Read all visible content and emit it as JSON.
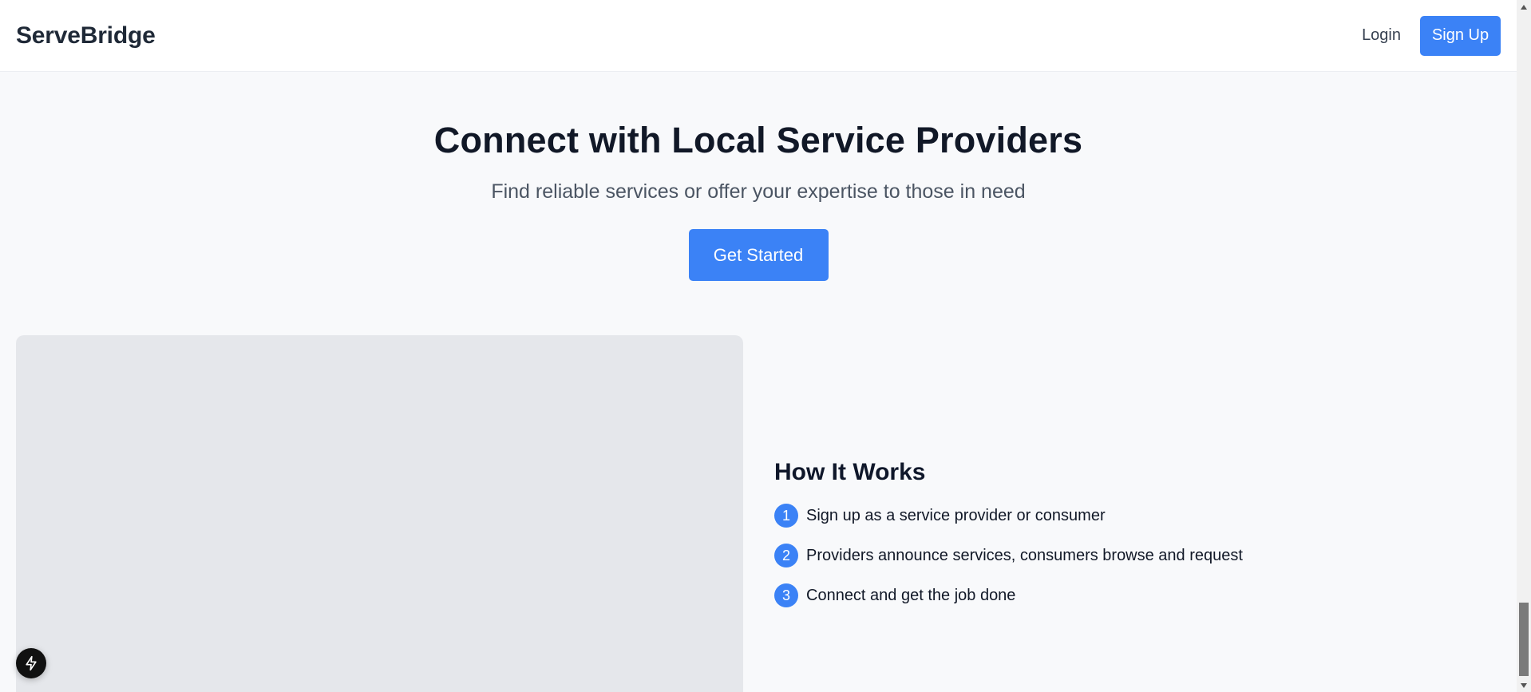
{
  "header": {
    "brand": "ServeBridge",
    "login_label": "Login",
    "signup_label": "Sign Up"
  },
  "hero": {
    "title": "Connect with Local Service Providers",
    "subtitle": "Find reliable services or offer your expertise to those in need",
    "cta_label": "Get Started"
  },
  "how_it_works": {
    "title": "How It Works",
    "steps": [
      {
        "number": "1",
        "text": "Sign up as a service provider or consumer"
      },
      {
        "number": "2",
        "text": "Providers announce services, consumers browse and request"
      },
      {
        "number": "3",
        "text": "Connect and get the job done"
      }
    ]
  },
  "icons": {
    "float_button": "lightning-bolt-icon",
    "scroll_up": "triangle-up-icon",
    "scroll_down": "triangle-down-icon"
  },
  "colors": {
    "accent": "#3b82f6",
    "background": "#f8f9fb",
    "placeholder": "#e5e7eb"
  }
}
